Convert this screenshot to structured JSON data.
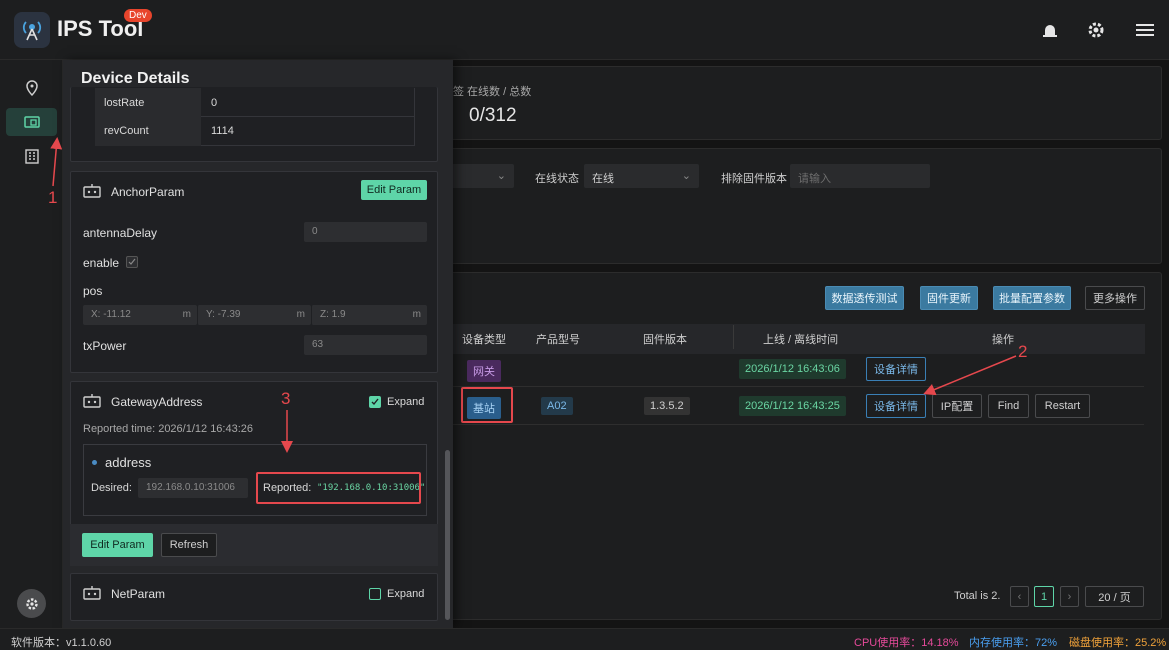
{
  "app": {
    "title": "IPS Tool",
    "badge": "Dev"
  },
  "status_bar": {
    "version": "软件版本：v1.1.0.60",
    "cpu": "CPU使用率：14.18%",
    "mem": "内存使用率：72%",
    "disk": "磁盘使用率：25.2%"
  },
  "bg": {
    "online_stat_label": "签 在线数 / 总数",
    "online_stat_value": "0/312",
    "filter_online_label": "在线状态",
    "filter_online_value": "在线",
    "filter_exclude_label": "排除固件版本",
    "filter_exclude_placeholder": "请输入",
    "toolbar": [
      "数据透传测试",
      "固件更新",
      "批量配置参数",
      "更多操作"
    ],
    "table_headers": [
      "设备类型",
      "产品型号",
      "固件版本",
      "上线 / 离线时间",
      "操作"
    ],
    "rows": [
      {
        "type": "网关",
        "model": "",
        "firmware": "",
        "time": "2026/1/12 16:43:06",
        "actions": [
          "设备详情"
        ]
      },
      {
        "type": "基站",
        "model": "A02",
        "firmware": "1.3.5.2",
        "time": "2026/1/12 16:43:25",
        "actions": [
          "设备详情",
          "IP配置",
          "Find",
          "Restart"
        ]
      }
    ],
    "pagination": {
      "total": "Total is 2.",
      "page": "1",
      "page_size": "20 / 页"
    }
  },
  "panel": {
    "title": "Device Details",
    "stats": [
      {
        "key": "lostRate",
        "value": "0"
      },
      {
        "key": "revCount",
        "value": "1114"
      }
    ],
    "anchor": {
      "title": "AnchorParam",
      "edit_label": "Edit Param",
      "antenna_label": "antennaDelay",
      "antenna_value": "0",
      "enable_label": "enable",
      "pos_label": "pos",
      "pos_x": "X: -11.12",
      "pos_y": "Y: -7.39",
      "pos_z": "Z: 1.9",
      "unit": "m",
      "tx_label": "txPower",
      "tx_value": "63"
    },
    "gateway": {
      "title": "GatewayAddress",
      "expand": "Expand",
      "reported_time": "Reported time: 2026/1/12 16:43:26",
      "field_name": "address",
      "desired_label": "Desired:",
      "desired_value": "192.168.0.10:31006",
      "reported_label": "Reported:",
      "reported_value": "\"192.168.0.10:31006\"",
      "edit_label": "Edit Param",
      "refresh_label": "Refresh"
    },
    "net": {
      "title": "NetParam",
      "expand": "Expand"
    }
  },
  "annotations": [
    "1",
    "2",
    "3"
  ]
}
